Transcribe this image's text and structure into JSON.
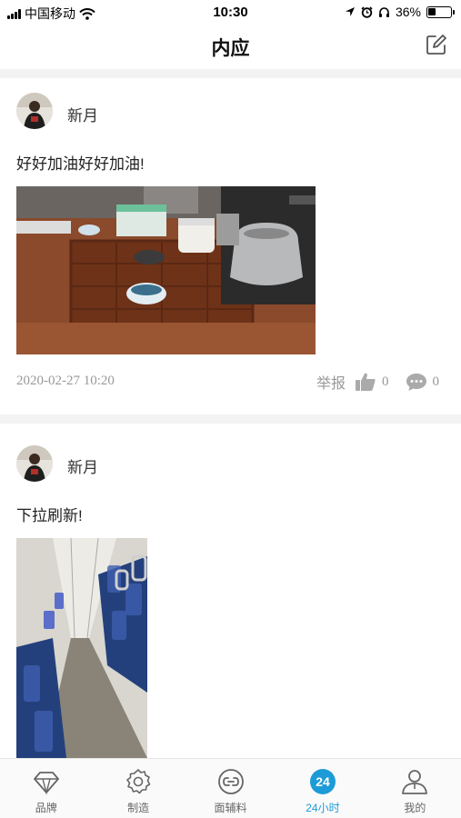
{
  "status_bar": {
    "carrier": "中国移动",
    "time": "10:30",
    "battery": "36%",
    "battery_level": 0.36
  },
  "header": {
    "title": "内应",
    "edit_icon": "edit-icon"
  },
  "posts": [
    {
      "username": "新月",
      "content": "好好加油好好加油!",
      "timestamp": "2020-02-27 10:20",
      "report_label": "举报",
      "likes": "0",
      "comments": "0"
    },
    {
      "username": "新月",
      "content": "下拉刷新!"
    }
  ],
  "tabs": [
    {
      "label": "品牌",
      "icon": "diamond-icon",
      "active": false
    },
    {
      "label": "制造",
      "icon": "gear-icon",
      "active": false
    },
    {
      "label": "面辅料",
      "icon": "link-icon",
      "active": false
    },
    {
      "label": "24小时",
      "icon": "clock-24-icon",
      "icon_text": "24",
      "active": true
    },
    {
      "label": "我的",
      "icon": "user-icon",
      "active": false
    }
  ],
  "colors": {
    "accent": "#1d9bd7",
    "muted_text": "#999999",
    "divider": "#f3f3f3"
  }
}
